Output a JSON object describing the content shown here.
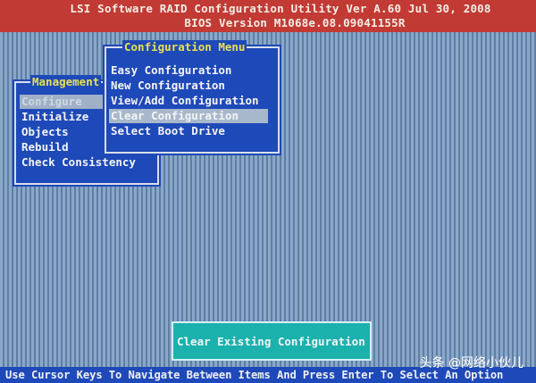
{
  "header": {
    "line1": "LSI Software RAID Configuration Utility Ver A.60 Jul 30, 2008",
    "line2": "BIOS Version M1068e.08.09041155R"
  },
  "management_menu": {
    "title": "Management",
    "items": [
      {
        "label": "Configure"
      },
      {
        "label": "Initialize"
      },
      {
        "label": "Objects"
      },
      {
        "label": "Rebuild"
      },
      {
        "label": "Check Consistency"
      }
    ]
  },
  "configuration_menu": {
    "title": "Configuration Menu",
    "items": [
      {
        "label": "Easy Configuration"
      },
      {
        "label": "New Configuration"
      },
      {
        "label": "View/Add Configuration"
      },
      {
        "label": "Clear Configuration"
      },
      {
        "label": "Select Boot Drive"
      }
    ]
  },
  "dialog": {
    "label": "Clear Existing Configuration"
  },
  "status_bar": {
    "text": "Use Cursor Keys To Navigate Between Items And Press Enter To Select An Option"
  },
  "watermark": {
    "text": "头条 @网络小伙儿"
  },
  "colors": {
    "title_bar": "#c23a34",
    "menu_bg": "#1e49b9",
    "menu_title": "#e8e050",
    "dialog_bg": "#1bb1ad"
  }
}
